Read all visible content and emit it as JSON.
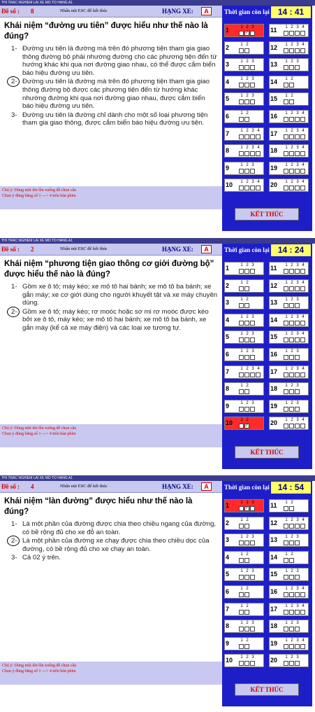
{
  "screens": [
    {
      "app_title": "THI TRAC NGHIEM LAI XE  MO TO  HANG A1",
      "deso_label": "Đề số :",
      "deso_value": "8",
      "esc_note": "Nhấn nút ESC để kết thúc",
      "hang_label": "HẠNG XE:",
      "hang_value": "A",
      "time_label": "Thời gian còn lại",
      "time_value": "14 : 41",
      "question": "Khái niệm “đường ưu tiên” được hiểu như thế nào là đúng?",
      "answers": [
        {
          "num": "1-",
          "text": "Đường ưu tiên là đường mà trên đó phương tiện tham gia giao thông đường bộ phải nhường đường cho các phương tiện đến từ hướng khác khi qua nơi đường giao nhau, có thể được cắm biển báo hiệu đường ưu tiên."
        },
        {
          "num": "2-",
          "text": "Đường ưu tiên là đường mà trên đó phương tiện tham gia giao thông đường bộ được các phương tiện đến từ hướng khác nhường đường khi qua nơi đường giao nhau, được cắm biển báo hiệu đường ưu tiên."
        },
        {
          "num": "3-",
          "text": "Đường ưu tiên là đường chỉ dành cho một số loại phương tiện tham gia giao thông, được cắm biển báo hiệu đường ưu tiên."
        }
      ],
      "note1": "Chú ý: Dùng mũi tên lên xuống để chọn câu",
      "note2": "Chọn ý đúng bằng số 1 ---> 4 trên bàn phím",
      "ketthuc": "KẾT THÚC",
      "active_cell": "1"
    },
    {
      "app_title": "THI TRAC NGHIEM LAI XE  MO TO  HANG A1",
      "deso_label": "Đề số :",
      "deso_value": "2",
      "esc_note": "Nhấn nút ESC để kết thúc",
      "hang_label": "HẠNG XE:",
      "hang_value": "A",
      "time_label": "Thời gian còn lại",
      "time_value": "14 : 24",
      "question": "Khái niệm “phương tiện giao thông cơ giới đường bộ” được hiểu thế nào là đúng?",
      "answers": [
        {
          "num": "1-",
          "text": "Gồm xe ô tô; máy kéo; xe mô tô hai bánh; xe mô tô ba bánh; xe gắn máy; xe cơ giới dùng cho người khuyết tật và xe máy chuyên dùng."
        },
        {
          "num": "2-",
          "text": "Gồm xe ô tô; máy kéo; rơ moóc hoặc sơ mi rơ moóc được kéo bởi xe ô tô, máy kéo; xe mô tô hai bánh; xe mô tô ba bánh, xe gắn máy (kể cả xe máy điện) và các loại xe tương tự."
        }
      ],
      "note1": "Chú ý: Dùng mũi tên lên xuống để chọn câu",
      "note2": "Chọn ý đúng bằng số 1 ---> 4 trên bàn phím",
      "ketthuc": "KẾT THÚC",
      "active_cell": "10"
    },
    {
      "app_title": "THI TRAC NGHIEM LAI XE  MO TO  HANG A1",
      "deso_label": "Đề số :",
      "deso_value": "4",
      "esc_note": "Nhấn nút ESC để kết thúc",
      "hang_label": "HẠNG XE:",
      "hang_value": "A",
      "time_label": "Thời gian còn lại",
      "time_value": "14 : 54",
      "question": "Khái niệm “làn đường” được hiểu như thế nào là đúng?",
      "answers": [
        {
          "num": "1-",
          "text": "Là một phần của đường được chia theo chiều ngang của đường, có bề rộng đủ cho xe đỗ an toàn."
        },
        {
          "num": "2-",
          "text": "Là một phần của đường xe chạy được chia theo chiều dọc của đường, có bề rộng đủ cho xe chạy an toàn."
        },
        {
          "num": "3-",
          "text": "Cả 02 ý trên."
        }
      ],
      "note1": "Chú ý: Dùng mũi tên lên xuống để chọn câu",
      "note2": "Chọn ý đúng bằng số 1 ---> 4 trên bàn phím",
      "ketthuc": "KẾT THÚC",
      "active_cell": "1"
    }
  ],
  "grids": [
    [
      {
        "n": "1",
        "d": "123",
        "sel": "2"
      },
      {
        "n": "11",
        "d": "1234",
        "sel": ""
      },
      {
        "n": "2",
        "d": "12",
        "sel": ""
      },
      {
        "n": "12",
        "d": "1234",
        "sel": ""
      },
      {
        "n": "3",
        "d": "123",
        "sel": ""
      },
      {
        "n": "13",
        "d": "123",
        "sel": ""
      },
      {
        "n": "4",
        "d": "123",
        "sel": ""
      },
      {
        "n": "14",
        "d": "12",
        "sel": ""
      },
      {
        "n": "5",
        "d": "123",
        "sel": ""
      },
      {
        "n": "15",
        "d": "12",
        "sel": ""
      },
      {
        "n": "6",
        "d": "12",
        "sel": ""
      },
      {
        "n": "16",
        "d": "1234",
        "sel": ""
      },
      {
        "n": "7",
        "d": "1234",
        "sel": ""
      },
      {
        "n": "17",
        "d": "1234",
        "sel": ""
      },
      {
        "n": "8",
        "d": "1234",
        "sel": ""
      },
      {
        "n": "18",
        "d": "1234",
        "sel": ""
      },
      {
        "n": "9",
        "d": "123",
        "sel": ""
      },
      {
        "n": "19",
        "d": "1234",
        "sel": ""
      },
      {
        "n": "10",
        "d": "1234",
        "sel": ""
      },
      {
        "n": "20",
        "d": "1234",
        "sel": ""
      }
    ],
    [
      {
        "n": "1",
        "d": "123",
        "sel": ""
      },
      {
        "n": "11",
        "d": "1234",
        "sel": ""
      },
      {
        "n": "2",
        "d": "12",
        "sel": ""
      },
      {
        "n": "12",
        "d": "1234",
        "sel": ""
      },
      {
        "n": "3",
        "d": "12",
        "sel": ""
      },
      {
        "n": "13",
        "d": "123",
        "sel": ""
      },
      {
        "n": "4",
        "d": "123",
        "sel": ""
      },
      {
        "n": "14",
        "d": "1234",
        "sel": ""
      },
      {
        "n": "5",
        "d": "123",
        "sel": ""
      },
      {
        "n": "15",
        "d": "1234",
        "sel": ""
      },
      {
        "n": "6",
        "d": "123",
        "sel": ""
      },
      {
        "n": "16",
        "d": "123",
        "sel": ""
      },
      {
        "n": "7",
        "d": "1234",
        "sel": ""
      },
      {
        "n": "17",
        "d": "1234",
        "sel": ""
      },
      {
        "n": "8",
        "d": "12",
        "sel": ""
      },
      {
        "n": "18",
        "d": "123",
        "sel": ""
      },
      {
        "n": "9",
        "d": "123",
        "sel": ""
      },
      {
        "n": "19",
        "d": "123",
        "sel": ""
      },
      {
        "n": "10",
        "d": "12",
        "sel": "2"
      },
      {
        "n": "20",
        "d": "1234",
        "sel": ""
      }
    ],
    [
      {
        "n": "1",
        "d": "123",
        "sel": "2"
      },
      {
        "n": "11",
        "d": "12",
        "sel": ""
      },
      {
        "n": "2",
        "d": "12",
        "sel": ""
      },
      {
        "n": "12",
        "d": "1234",
        "sel": ""
      },
      {
        "n": "3",
        "d": "123",
        "sel": ""
      },
      {
        "n": "13",
        "d": "123",
        "sel": ""
      },
      {
        "n": "4",
        "d": "12",
        "sel": ""
      },
      {
        "n": "14",
        "d": "12",
        "sel": ""
      },
      {
        "n": "5",
        "d": "123",
        "sel": ""
      },
      {
        "n": "15",
        "d": "123",
        "sel": ""
      },
      {
        "n": "6",
        "d": "12",
        "sel": ""
      },
      {
        "n": "16",
        "d": "1234",
        "sel": ""
      },
      {
        "n": "7",
        "d": "12",
        "sel": ""
      },
      {
        "n": "17",
        "d": "1234",
        "sel": ""
      },
      {
        "n": "8",
        "d": "123",
        "sel": ""
      },
      {
        "n": "18",
        "d": "123",
        "sel": ""
      },
      {
        "n": "9",
        "d": "12",
        "sel": ""
      },
      {
        "n": "19",
        "d": "1234",
        "sel": ""
      },
      {
        "n": "10",
        "d": "123",
        "sel": ""
      },
      {
        "n": "20",
        "d": "123",
        "sel": ""
      }
    ]
  ]
}
